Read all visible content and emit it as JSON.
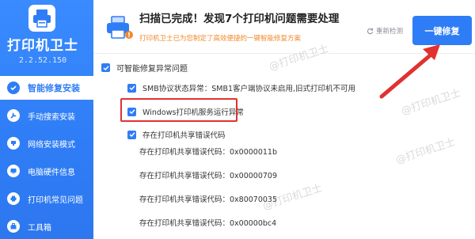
{
  "app": {
    "title": "打印机卫士",
    "version": "2.2.52.150"
  },
  "sidebar": {
    "items": [
      {
        "label": "智能修复安装",
        "active": true
      },
      {
        "label": "手动搜索安装"
      },
      {
        "label": "网络安装模式"
      },
      {
        "label": "电脑硬件信息"
      },
      {
        "label": "打印机常见问题"
      },
      {
        "label": "工具箱"
      }
    ]
  },
  "header": {
    "title": "扫描已完成！发现7个打印机问题需要处理",
    "subtitle": "打印机卫士已为您制定了高效便捷的一键智能修复方案",
    "recheck_label": "重新检测",
    "repair_button": "一键修复"
  },
  "issues": {
    "group_label": "可智能修复异常问题",
    "smb_issue": "SMB协议状态异常：SMB1客户端协议未启用,旧式打印机不可用",
    "service_issue": "Windows打印机服务运行异常",
    "share_issue": "存在打印机共享错误代码",
    "share_codes": [
      "存在打印机共享错误代码：0x0000011b",
      "存在打印机共享错误代码：0x00000709",
      "存在打印机共享错误代码：0x80070035",
      "存在打印机共享错误代码：0x00000bc4"
    ]
  },
  "watermarks": [
    "@打印机卫士",
    "@打印机卫士",
    "@打印机卫士",
    "@打印机卫士"
  ],
  "colors": {
    "accent": "#2f7df6",
    "warning_text": "#f08a2a",
    "annotation_red": "#e0322f"
  }
}
